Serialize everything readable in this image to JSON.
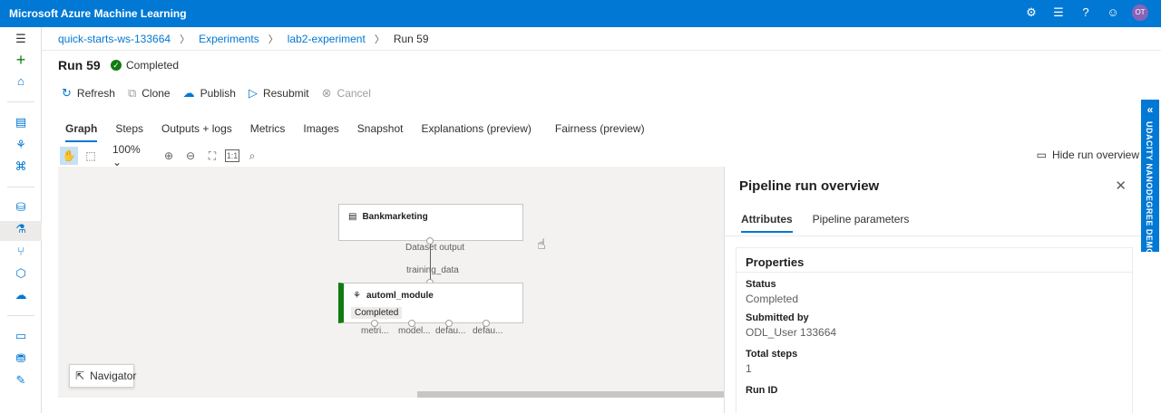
{
  "app": {
    "title": "Microsoft Azure Machine Learning",
    "avatar_initials": "OT"
  },
  "breadcrumb": [
    "quick-starts-ws-133664",
    "Experiments",
    "lab2-experiment",
    "Run 59"
  ],
  "run": {
    "title": "Run 59",
    "status": "Completed"
  },
  "commands": {
    "refresh": "Refresh",
    "clone": "Clone",
    "publish": "Publish",
    "resubmit": "Resubmit",
    "cancel": "Cancel"
  },
  "tabs": [
    "Graph",
    "Steps",
    "Outputs + logs",
    "Metrics",
    "Images",
    "Snapshot",
    "Explanations (preview)",
    "Fairness (preview)"
  ],
  "graph_toolbar": {
    "zoom": "100%",
    "hide_overview": "Hide run overview"
  },
  "graph": {
    "node1": {
      "title": "Bankmarketing"
    },
    "node2": {
      "title": "automl_module",
      "status": "Completed"
    },
    "edge_output_label": "Dataset output",
    "edge_input_label": "training_data",
    "output_ports": [
      "metri...",
      "model...",
      "defau...",
      "defau..."
    ],
    "navigator": "Navigator"
  },
  "panel": {
    "title": "Pipeline run overview",
    "tabs": [
      "Attributes",
      "Pipeline parameters"
    ],
    "section_title": "Properties",
    "properties": [
      {
        "key": "Status",
        "value": "Completed"
      },
      {
        "key": "Submitted by",
        "value": "ODL_User 133664"
      },
      {
        "key": "Total steps",
        "value": "1"
      },
      {
        "key": "Run ID",
        "value": ""
      }
    ]
  },
  "side_banner": "UDACITY NANODEGREE DEMO",
  "colors": {
    "accent": "#0078d4",
    "success": "#107c10"
  }
}
